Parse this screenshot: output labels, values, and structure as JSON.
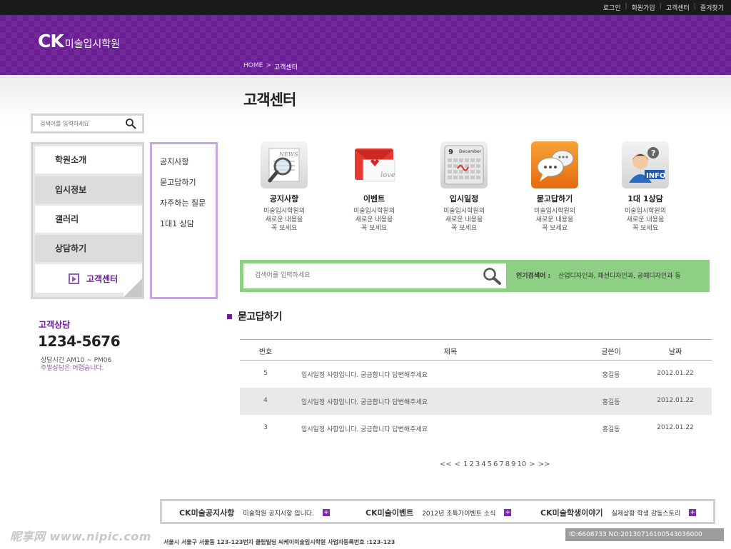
{
  "topbar": {
    "links": [
      "로그인",
      "회원가입",
      "고객센터",
      "즐겨찾기"
    ]
  },
  "header": {
    "logo_ck": "CK",
    "logo_name": "미술입시학원"
  },
  "breadcrumb": {
    "home": "HOME",
    "separator": ">",
    "current": "고객센터"
  },
  "page_title": "고객센터",
  "side_search": {
    "placeholder": "검색어를 입력하세요"
  },
  "side_menu": {
    "items": [
      "학원소개",
      "입시정보",
      "갤러리",
      "상담하기"
    ],
    "active": "고객센터"
  },
  "sub_menu": {
    "items": [
      "공지사항",
      "묻고답하기",
      "자주하는 질문",
      "1대1 상담"
    ]
  },
  "contact": {
    "title": "고객상담",
    "phone": "1234-5676",
    "hours": "상담시간 AM10 ~ PM06",
    "note": "주말상담은 어렵습니다."
  },
  "services": [
    {
      "title": "공지사항",
      "icon": "newspaper-magnifier-icon",
      "desc": [
        "미술입시학원의",
        "새로운 내용을",
        "꼭 보세요"
      ]
    },
    {
      "title": "이벤트",
      "icon": "love-letter-icon",
      "desc": [
        "미술입시학원의",
        "새로운 내용을",
        "꼭 보세요"
      ]
    },
    {
      "title": "입시일정",
      "icon": "calendar-icon",
      "desc": [
        "미술입시학원의",
        "새로운 내용을",
        "꼭 보세요"
      ]
    },
    {
      "title": "묻고답하기",
      "icon": "chat-bubbles-icon",
      "desc": [
        "미술입시학원의",
        "새로운 내용을",
        "꼭 보세요"
      ]
    },
    {
      "title": "1대 1상담",
      "icon": "info-operator-icon",
      "desc": [
        "미술입시학원의",
        "새로운 내용을",
        "꼭 보세요"
      ]
    }
  ],
  "service_icon_text": {
    "news": "NEWS",
    "love": "love",
    "cal_day": "9",
    "cal_month": "December",
    "info": "INFO",
    "question": "?"
  },
  "main_search": {
    "placeholder": "검색어를 입력하세요",
    "popular_label": "인기검색어 :",
    "popular_words": "산업디자인과, 패션디자인과, 공예디자인과 등"
  },
  "board": {
    "section_title": "묻고답하기",
    "columns": [
      "번호",
      "제목",
      "글쓴이",
      "날짜"
    ],
    "rows": [
      {
        "num": "5",
        "title": "입시일정 사항입니다. 궁금합니다 답변해주세요",
        "author": "홍길동",
        "date": "2012.01.22"
      },
      {
        "num": "4",
        "title": "입시일정 사항입니다. 궁금합니다 답변해주세요",
        "author": "홍길동",
        "date": "2012.01.22"
      },
      {
        "num": "3",
        "title": "입시일정 사항입니다. 궁금합니다 답변해주세요",
        "author": "홍길동",
        "date": "2012.01.22"
      }
    ]
  },
  "pager": {
    "prev": "<<",
    "prev_one": "<",
    "pages": [
      "1",
      "2",
      "3",
      "4",
      "5",
      "6",
      "7",
      "8",
      "9",
      "10"
    ],
    "next_one": ">",
    "next": ">>"
  },
  "banner": [
    {
      "title": "CK미술공지사항",
      "text": "미술학원 공지사항 입니다."
    },
    {
      "title": "CK미술이벤트",
      "text": "2012년 초특가이벤트 소식"
    },
    {
      "title": "CK미술학생이야기",
      "text": "실제상황 학생 감동스토리"
    }
  ],
  "banner_more_symbol": "+",
  "address": "서울시 서울구 서울동 123-123번지 클립빌딩 씨케이미술입시학원 사업자등록번호 :123-123",
  "watermark": {
    "left": "昵享网 www.nipic.com",
    "right": "ID:6608733 NO:20130716100543036000"
  },
  "colors": {
    "brand_purple": "#6a1d94",
    "search_green": "#8ed083",
    "submenu_border": "#c6a7e0"
  }
}
